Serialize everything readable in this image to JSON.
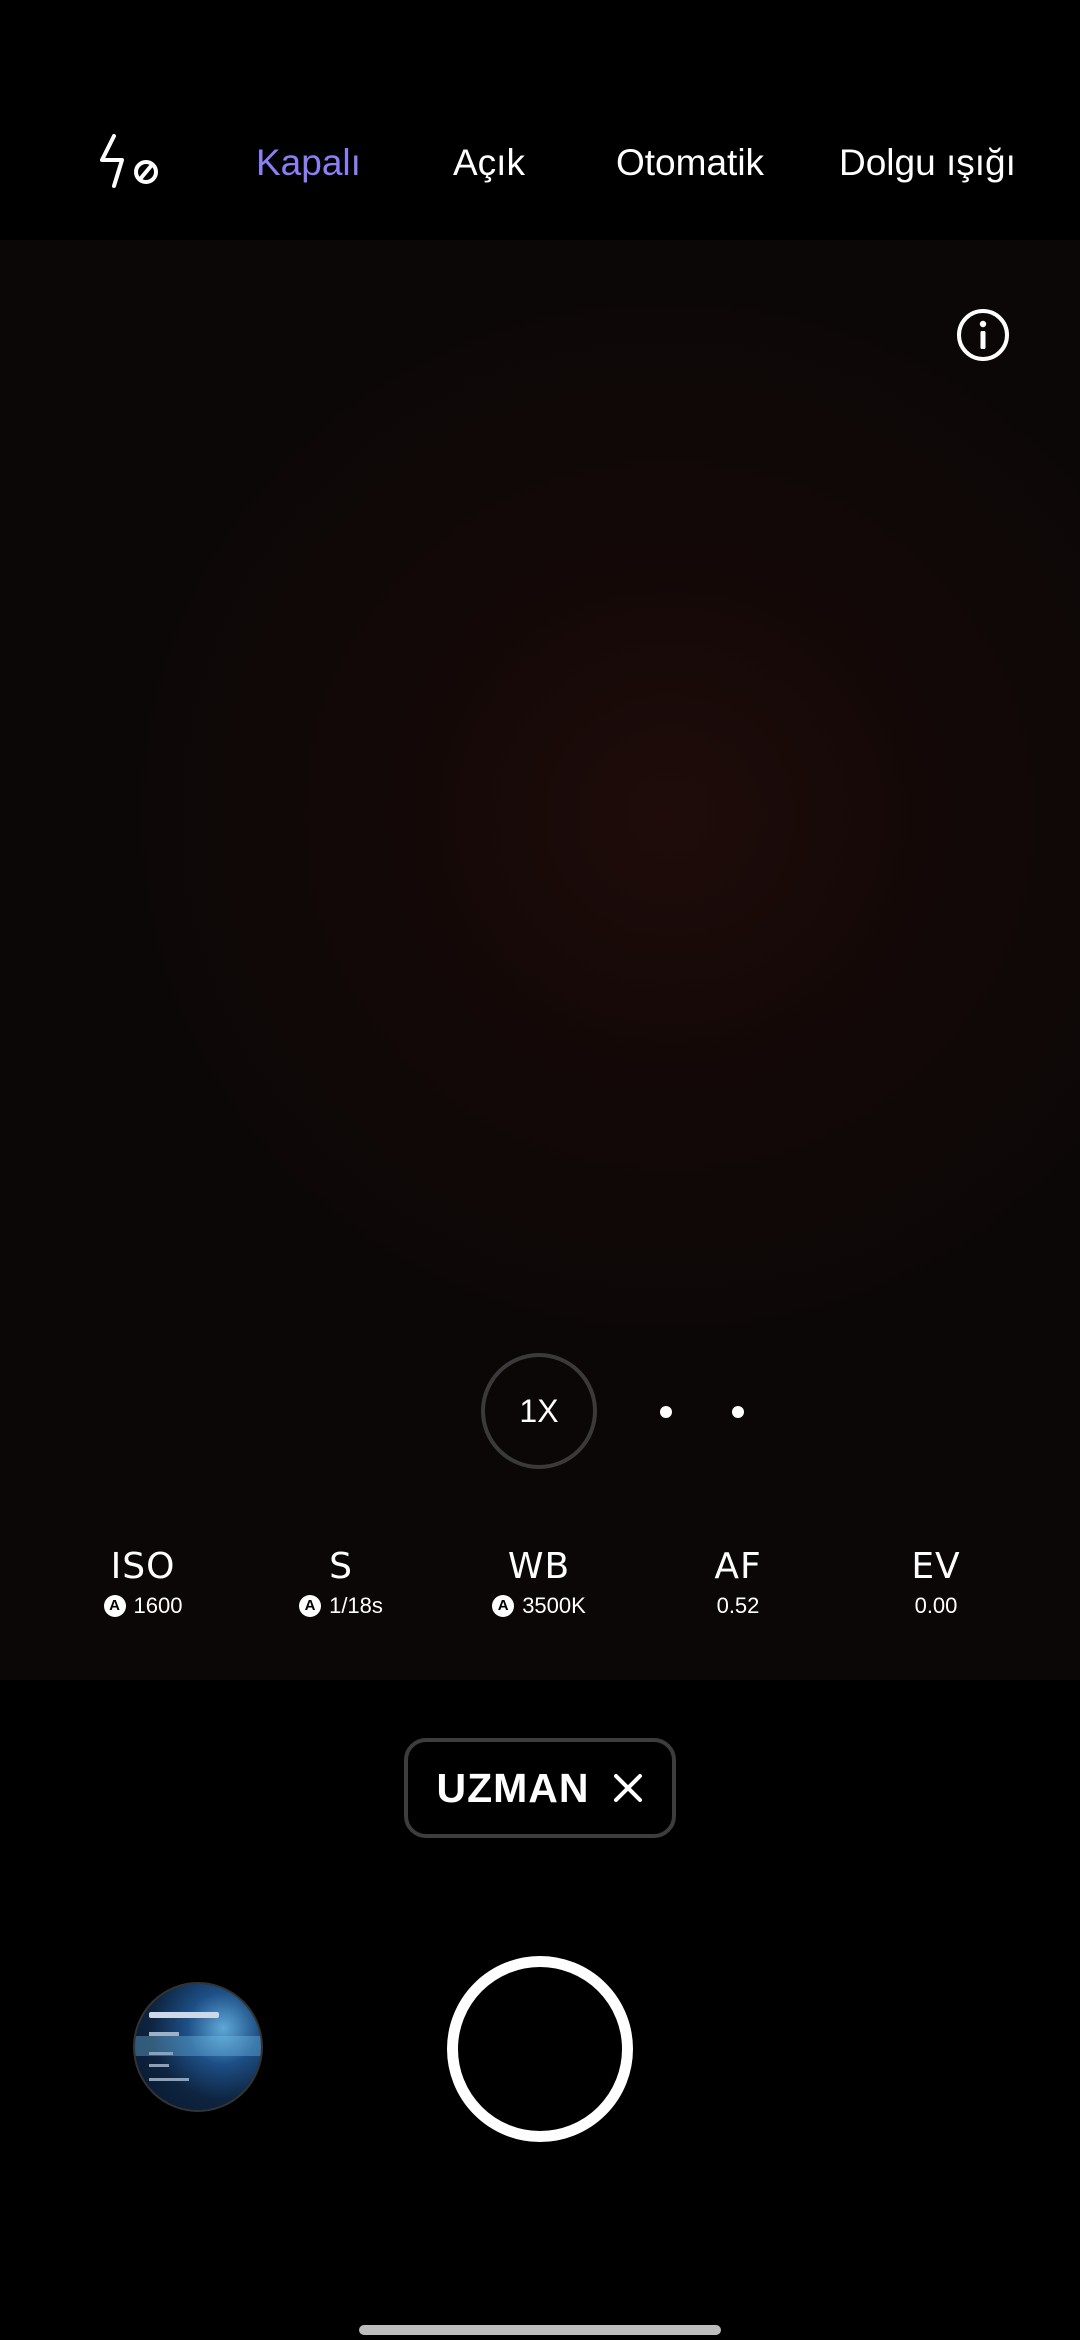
{
  "flash": {
    "icon": "flash-off-icon",
    "options": [
      {
        "label": "Kapalı",
        "active": true
      },
      {
        "label": "Açık",
        "active": false
      },
      {
        "label": "Otomatik",
        "active": false
      },
      {
        "label": "Dolgu ışığı",
        "active": false
      }
    ],
    "active_color": "#8b7ff5"
  },
  "viewfinder": {
    "info_icon": "info-icon"
  },
  "zoom": {
    "label": "1X"
  },
  "params": {
    "iso": {
      "label": "ISO",
      "auto": "A",
      "value": "1600"
    },
    "shutter": {
      "label": "S",
      "auto": "A",
      "value": "1/18s"
    },
    "wb": {
      "label": "WB",
      "auto": "A",
      "value": "3500K"
    },
    "af": {
      "label": "AF",
      "value": "0.52"
    },
    "ev": {
      "label": "EV",
      "value": "0.00"
    }
  },
  "mode": {
    "label": "UZMAN",
    "close_icon": "close-icon"
  },
  "gallery": {
    "icon": "gallery-thumbnail"
  }
}
